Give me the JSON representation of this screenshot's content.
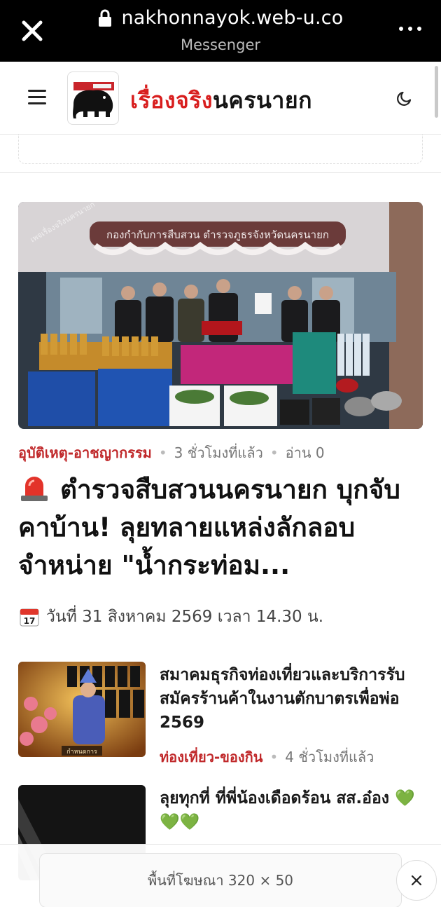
{
  "browser": {
    "url": "nakhonnayok.web-u.co",
    "subtitle": "Messenger"
  },
  "site": {
    "title_red": "เรื่องจริง",
    "title_dark": "นครนายก"
  },
  "hero": {
    "banner_text": "กองกำกับการสืบสวน ตำรวจภูธรจังหวัดนครนายก",
    "watermark": "เพจเรื่องจริงนครนายก"
  },
  "featured": {
    "category": "อุบัติเหตุ-อาชญากรรม",
    "time": "3 ชั่วโมงที่แล้ว",
    "reads": "อ่าน 0",
    "headline": "ตำรวจสืบสวนนครนายก บุกจับคาบ้าน! ลุยทลายแหล่งลักลอบจำหน่าย \"น้ำกระท่อม...",
    "date_text": "วันที่ 31 สิงหาคม 2569 เวลา 14.30 น.",
    "calendar_label": "17"
  },
  "articles": [
    {
      "title": "สมาคมธุรกิจท่องเที่ยวและบริการรับสมัครร้านค้าในงานตักบาตรเพื่อพ่อ 2569",
      "category": "ท่องเที่ยว-ของกิน",
      "time": "4 ชั่วโมงที่แล้ว",
      "thumb_caption": "กำหนดการ"
    },
    {
      "title": "ลุยทุกที่ ที่พี่น้องเดือดร้อน สส.อ๋อง 💚💚💚"
    }
  ],
  "bottom_ad": {
    "label": "พื้นที่โฆษณา 320 × 50"
  },
  "colors": {
    "accent_red": "#d81e1e",
    "category_red": "#c0282a",
    "browser_bar": "#000000"
  }
}
